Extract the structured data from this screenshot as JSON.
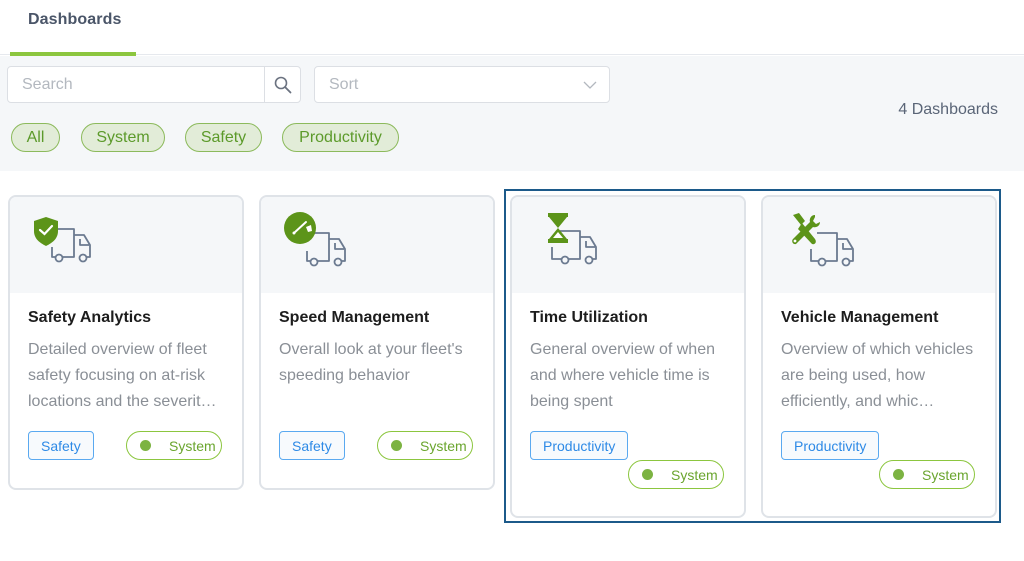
{
  "header": {
    "tabs": [
      {
        "label": "Dashboards",
        "active": true
      }
    ],
    "accent_color": "#8cc63f"
  },
  "filters": {
    "search": {
      "placeholder": "Search",
      "value": "",
      "icon": "search-icon"
    },
    "sort": {
      "placeholder": "Sort",
      "icon": "chevron-down-icon"
    },
    "chips": [
      {
        "label": "All"
      },
      {
        "label": "System"
      },
      {
        "label": "Safety"
      },
      {
        "label": "Productivity"
      }
    ],
    "count_label": "4 Dashboards"
  },
  "cards": [
    {
      "title": "Safety Analytics",
      "description": "Detailed overview of fleet safety focusing on at-risk locations and the severit…",
      "icon": "shield-check-truck-icon",
      "category": "Safety",
      "system_label": "System"
    },
    {
      "title": "Speed Management",
      "description": "Overall look at your fleet's speeding behavior",
      "icon": "speedometer-truck-icon",
      "category": "Safety",
      "system_label": "System"
    },
    {
      "title": "Time Utilization",
      "description": "General overview of when and where vehicle time is being spent",
      "icon": "hourglass-truck-icon",
      "category": "Productivity",
      "system_label": "System"
    },
    {
      "title": "Vehicle Management",
      "description": "Overview of which vehicles are being used, how efficiently, and whic…",
      "icon": "tools-truck-icon",
      "category": "Productivity",
      "system_label": "System"
    }
  ],
  "colors": {
    "brand_green": "#7cb342",
    "category_blue": "#2e8ae6",
    "selection_blue": "#1c5a8a"
  }
}
